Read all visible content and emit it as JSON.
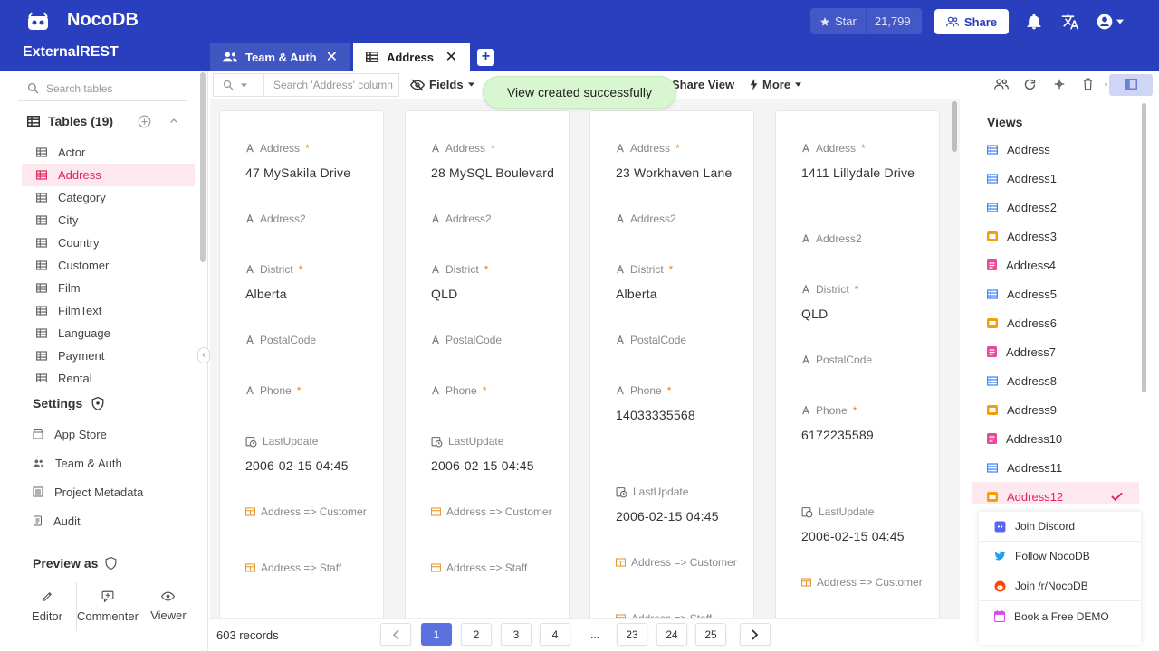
{
  "header": {
    "brand": "NocoDB",
    "project": "ExternalREST",
    "star_label": "Star",
    "star_count": "21,799",
    "share_label": "Share"
  },
  "tabs": [
    {
      "label": "Team & Auth",
      "icon": "team-icon"
    },
    {
      "label": "Address",
      "icon": "grid-icon"
    }
  ],
  "sidebar": {
    "search_placeholder": "Search tables",
    "tables_header": "Tables (19)",
    "tables": [
      "Actor",
      "Address",
      "Category",
      "City",
      "Country",
      "Customer",
      "Film",
      "FilmText",
      "Language",
      "Payment",
      "Rental"
    ],
    "active_table": "Address",
    "settings_header": "Settings",
    "settings_items": [
      "App Store",
      "Team & Auth",
      "Project Metadata",
      "Audit"
    ],
    "preview_header": "Preview as",
    "roles": [
      "Editor",
      "Commenter",
      "Viewer"
    ]
  },
  "toolbar": {
    "search_placeholder": "Search 'Address' column",
    "fields_label": "Fields",
    "share_view_label": "Share View",
    "more_label": "More",
    "toast": "View created successfully"
  },
  "gallery": {
    "labels": {
      "address": "Address",
      "address2": "Address2",
      "district": "District",
      "postal": "PostalCode",
      "phone": "Phone",
      "lastupdate": "LastUpdate",
      "rel_customer": "Address => Customer",
      "rel_staff": "Address => Staff",
      "required_mark": "*"
    },
    "cards": [
      {
        "address": "47 MySakila Drive",
        "district": "Alberta",
        "phone": "",
        "lastupdate": "2006-02-15 04:45"
      },
      {
        "address": "28 MySQL Boulevard",
        "district": "QLD",
        "phone": "",
        "lastupdate": "2006-02-15 04:45"
      },
      {
        "address": "23 Workhaven Lane",
        "district": "Alberta",
        "phone": "14033335568",
        "lastupdate": "2006-02-15 04:45"
      },
      {
        "address": "1411 Lillydale Drive",
        "district": "QLD",
        "phone": "6172235589",
        "lastupdate": "2006-02-15 04:45"
      }
    ]
  },
  "footer": {
    "records": "603 records",
    "pages": [
      "1",
      "2",
      "3",
      "4",
      "...",
      "23",
      "24",
      "25"
    ],
    "current_page": "1"
  },
  "views": {
    "title": "Views",
    "items": [
      {
        "name": "Address",
        "type": "grid"
      },
      {
        "name": "Address1",
        "type": "grid"
      },
      {
        "name": "Address2",
        "type": "grid"
      },
      {
        "name": "Address3",
        "type": "gallery"
      },
      {
        "name": "Address4",
        "type": "form"
      },
      {
        "name": "Address5",
        "type": "grid"
      },
      {
        "name": "Address6",
        "type": "gallery"
      },
      {
        "name": "Address7",
        "type": "form"
      },
      {
        "name": "Address8",
        "type": "grid"
      },
      {
        "name": "Address9",
        "type": "gallery"
      },
      {
        "name": "Address10",
        "type": "form"
      },
      {
        "name": "Address11",
        "type": "grid"
      },
      {
        "name": "Address12",
        "type": "gallery"
      }
    ],
    "active_view": "Address12",
    "colors": {
      "grid": "#3b82f6",
      "gallery": "#f59e0b",
      "form": "#ec4899"
    }
  },
  "community": [
    {
      "label": "Join Discord",
      "icon": "discord-icon",
      "color": "#5865f2"
    },
    {
      "label": "Follow NocoDB",
      "icon": "twitter-icon",
      "color": "#1da1f2"
    },
    {
      "label": "Join /r/NocoDB",
      "icon": "reddit-icon",
      "color": "#ff4500"
    },
    {
      "label": "Book a Free DEMO",
      "icon": "calendar-icon",
      "color": "#d946ef"
    }
  ],
  "colors": {
    "brand": "#2a3fbd",
    "accent_pink": "#e0245e",
    "toast_bg": "#d8f7d0",
    "page_active": "#5b71e0"
  }
}
